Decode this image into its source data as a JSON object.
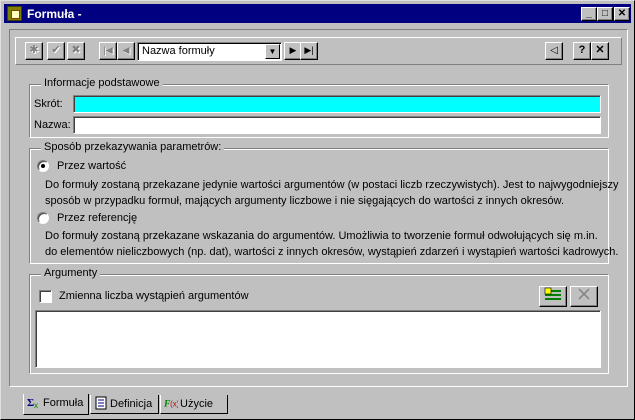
{
  "window": {
    "title": "Formuła -",
    "controls": {
      "minimize": "_",
      "maximize": "□",
      "close": "✕"
    }
  },
  "toolbar": {
    "new_icon": "✱",
    "accept_icon": "✔",
    "cancel_icon": "✖",
    "first_icon": "|◀",
    "prev_icon": "◀",
    "combo_value": "Nazwa formuły",
    "next_icon": "▶",
    "last_icon": "▶|",
    "back_icon": "◁",
    "help_label": "?",
    "close_label": "✕"
  },
  "basic_info": {
    "legend": "Informacje podstawowe",
    "shortcut_label": "Skrót:",
    "shortcut_value": "",
    "name_label": "Nazwa:",
    "name_value": ""
  },
  "params": {
    "legend": "Sposób przekazywania parametrów:",
    "by_value_label": "Przez wartość",
    "by_value_desc_1": "Do formuły zostaną przekazane jedynie wartości argumentów (w postaci liczb rzeczywistych). Jest to najwygodniejszy",
    "by_value_desc_2": "sposób w przypadku formuł, mających argumenty liczbowe i nie sięgających do wartości z innych okresów.",
    "by_ref_label": "Przez referencję",
    "by_ref_desc_1": "Do formuły zostaną przekazane wskazania do argumentów. Umożliwia to tworzenie formuł odwołujących się m.in.",
    "by_ref_desc_2": "do elementów nieliczbowych (np. dat), wartości z innych okresów, wystąpień zdarzeń i wystąpień wartości kadrowych.",
    "selected": "by_value"
  },
  "arguments": {
    "legend": "Argumenty",
    "variable_count_label": "Zmienna liczba wystąpień argumentów",
    "variable_count_checked": false
  },
  "tabs": [
    {
      "label": "Formuła"
    },
    {
      "label": "Definicja"
    },
    {
      "label": "Użycie"
    }
  ],
  "colors": {
    "shortcut_field": "#00ffff",
    "titlebar": "#000080",
    "face": "#c0c0c0"
  }
}
